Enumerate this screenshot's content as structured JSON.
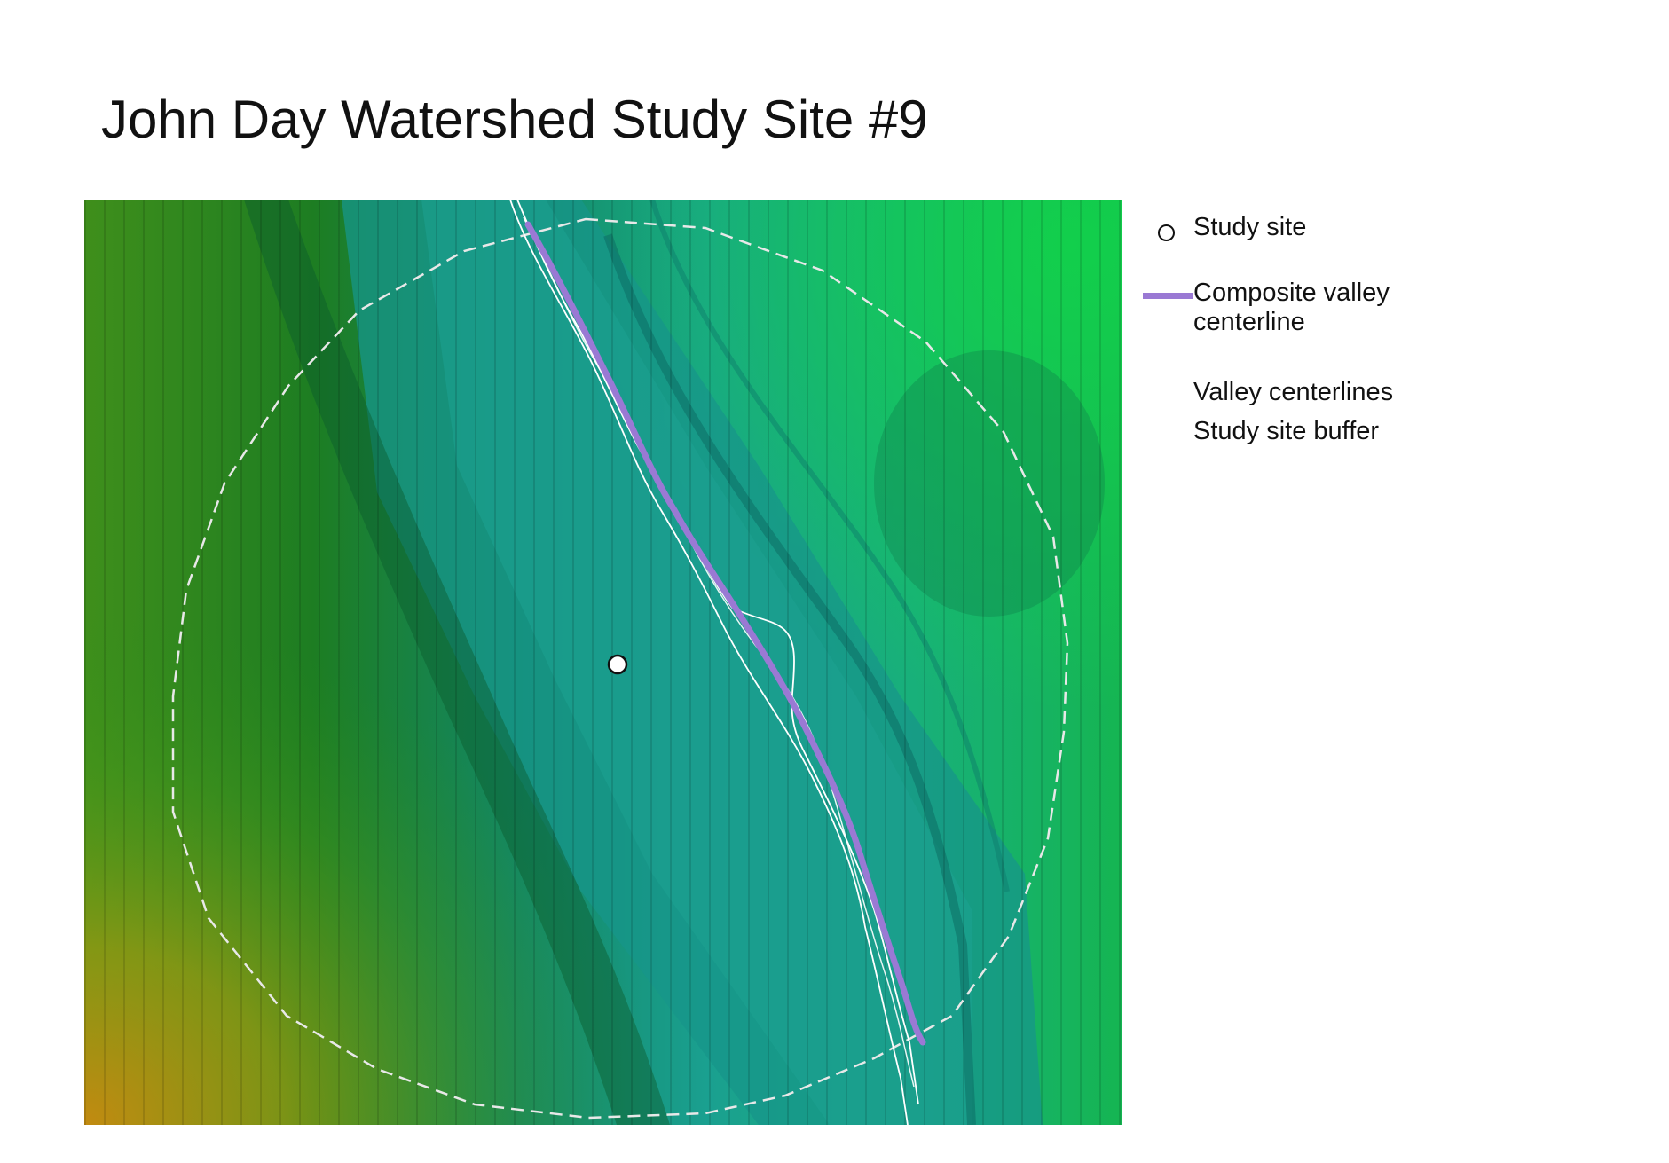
{
  "title": "John Day Watershed Study Site #9",
  "legend": {
    "items": [
      {
        "symbol": "circle",
        "label": "Study site"
      },
      {
        "symbol": "line",
        "label": "Composite valley\ncenterline"
      },
      {
        "symbol": "none",
        "label": "Valley centerlines"
      },
      {
        "symbol": "none",
        "label": "Study site buffer"
      }
    ]
  },
  "colors": {
    "composite_centerline": "#9a79d4",
    "valley_centerlines": "#ffffff",
    "buffer": "#e8e8e8",
    "study_site_fill": "#ffffff",
    "study_site_stroke": "#111111",
    "terrain_low": "#0f9a8a",
    "terrain_mid": "#0f8f2a",
    "terrain_high": "#c8860e"
  }
}
